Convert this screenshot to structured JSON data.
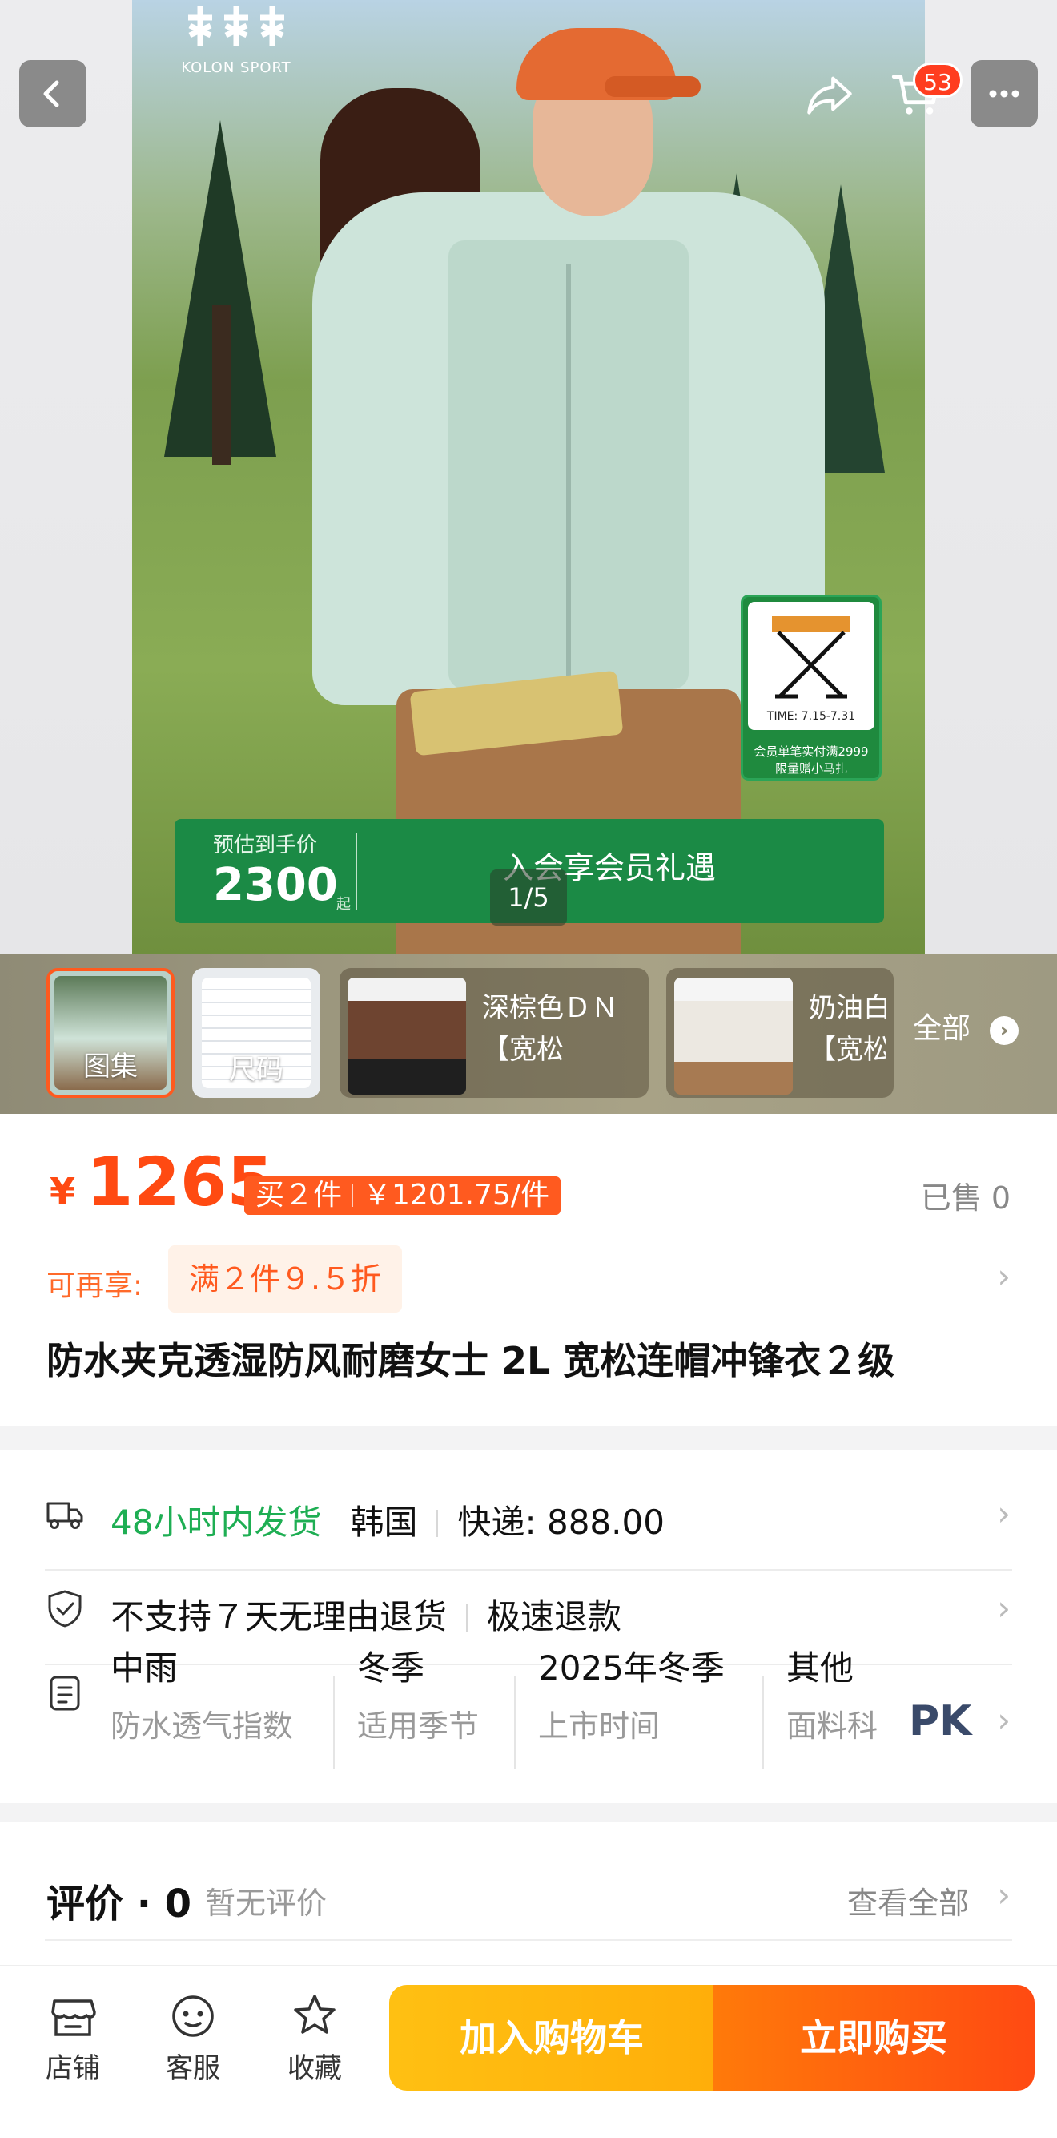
{
  "brand": {
    "name": "KOLON SPORT",
    "mark": "ℳℳ"
  },
  "header": {
    "cart_count": "53"
  },
  "hero": {
    "gift": {
      "time": "TIME: 7.15-7.31",
      "caption_line1": "会员单笔实付满2999",
      "caption_line2": "限量赠小马扎"
    },
    "banner": {
      "estimate_label": "预估到手价",
      "estimate_value": "2300",
      "qi": "起",
      "cta": "入会享会员礼遇"
    },
    "pager": "1/5"
  },
  "thumbs": {
    "items": [
      {
        "label": "图集"
      },
      {
        "label": "尺码"
      },
      {
        "desc_line1": "深棕色ＤＮ",
        "desc_line2": "【宽松"
      },
      {
        "desc_line1": "奶油白Ｒ",
        "desc_line2": "【宽松"
      }
    ],
    "all_label": "全部"
  },
  "price": {
    "symbol": "¥",
    "value": "1265",
    "deal_qty": "买２件",
    "deal_price": "￥1201.75/件",
    "sold": "已售 0",
    "promo_label": "可再享:",
    "promo_chip": "满２件９.５折",
    "title": "防水夹克透湿防风耐磨女士 2L 宽松连帽冲锋衣２级"
  },
  "shipping": {
    "dispatch": "48小时内发货",
    "origin": "韩国",
    "fee": "快递: 888.00"
  },
  "returns": {
    "policy": "不支持７天无理由退货",
    "refund": "极速退款"
  },
  "specs": [
    {
      "value": "中雨",
      "key": "防水透气指数"
    },
    {
      "value": "冬季",
      "key": "适用季节"
    },
    {
      "value": "2025年冬季",
      "key": "上市时间"
    },
    {
      "value": "其他",
      "key": "面料科"
    }
  ],
  "pk": "PK",
  "reviews": {
    "title": "评价 · 0",
    "none": "暂无评价",
    "view_all": "查看全部"
  },
  "bottom": {
    "store": "店铺",
    "service": "客服",
    "favorite": "收藏",
    "add_to_cart": "加入购物车",
    "buy_now": "立即购买"
  },
  "colors": {
    "accent": "#ff4a12",
    "green": "#1eae53",
    "cart_btn": "#ffb80f"
  }
}
